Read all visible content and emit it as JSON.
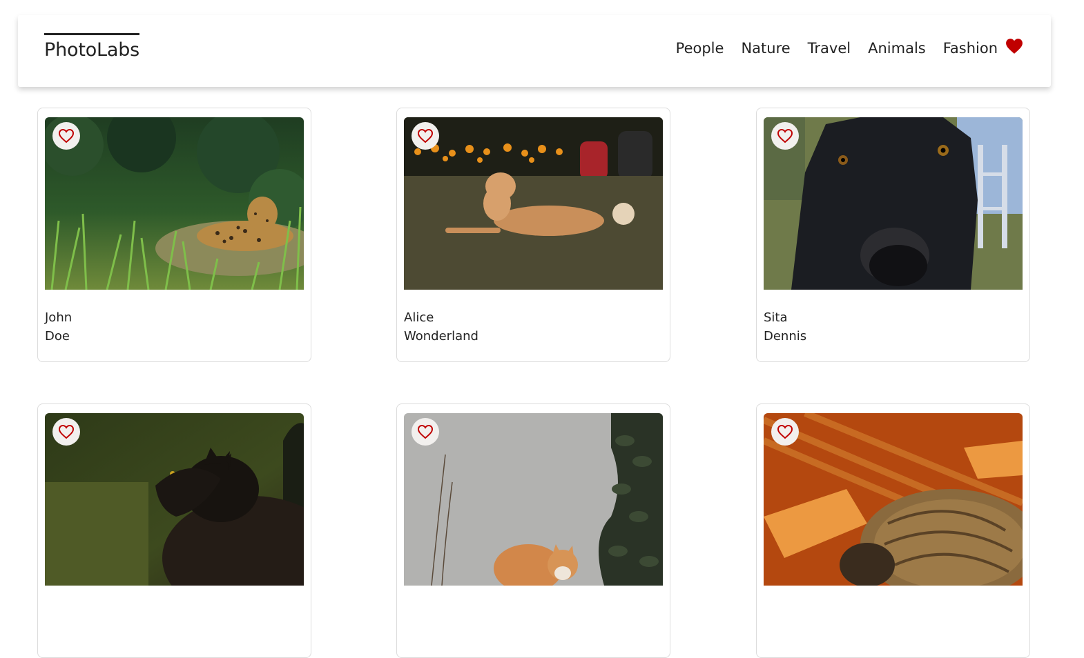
{
  "app": {
    "logo": "PhotoLabs"
  },
  "nav": {
    "topics": [
      "People",
      "Nature",
      "Travel",
      "Animals",
      "Fashion"
    ],
    "favourite_icon": "heart-filled-icon",
    "accent_color": "#c00000"
  },
  "photos": [
    {
      "first": "John",
      "last": "Doe",
      "subject": "jaguar-in-grass"
    },
    {
      "first": "Alice",
      "last": "Wonderland",
      "subject": "dog-on-lawn"
    },
    {
      "first": "Sita",
      "last": "Dennis",
      "subject": "black-dog-closeup"
    },
    {
      "first": "",
      "last": "",
      "subject": "black-cat"
    },
    {
      "first": "",
      "last": "",
      "subject": "orange-cat-by-wall"
    },
    {
      "first": "",
      "last": "",
      "subject": "tabby-cat-in-sunlight"
    }
  ]
}
